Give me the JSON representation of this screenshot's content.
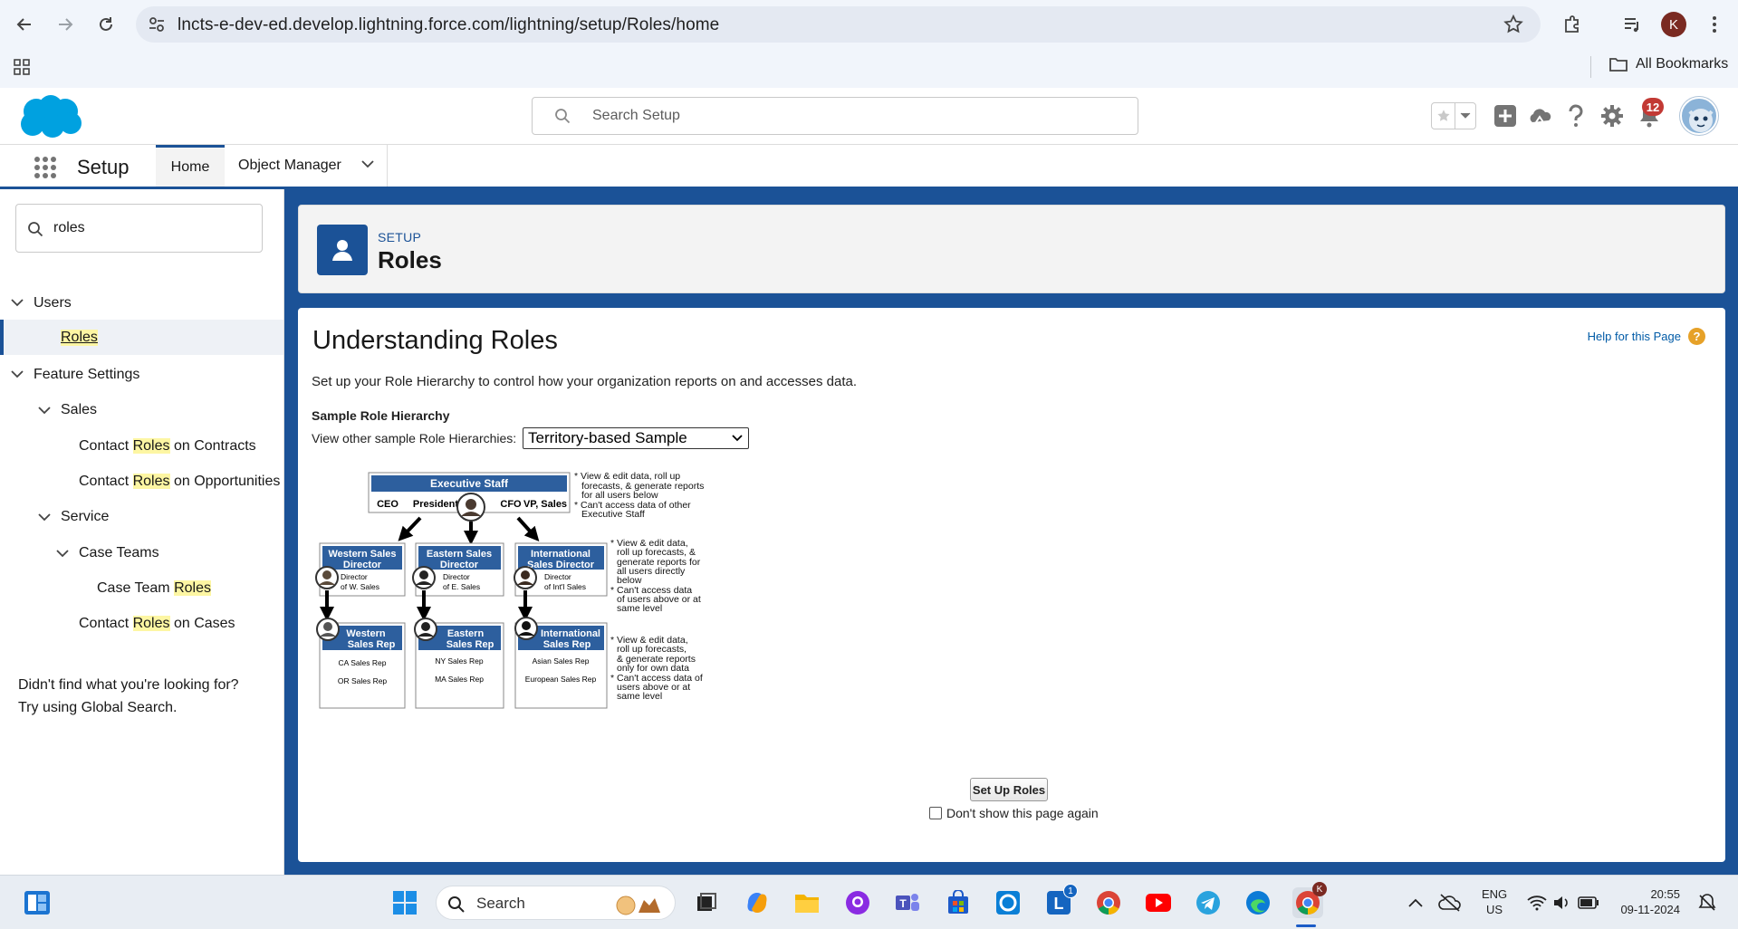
{
  "browser": {
    "url": "lncts-e-dev-ed.develop.lightning.force.com/lightning/setup/Roles/home",
    "profile_initial": "K",
    "bookmarks_label": "All Bookmarks"
  },
  "sf_header": {
    "search_placeholder": "Search Setup",
    "notification_count": "12"
  },
  "app_nav": {
    "app_name": "Setup",
    "tabs": [
      {
        "label": "Home",
        "active": true
      },
      {
        "label": "Object Manager",
        "active": false
      }
    ]
  },
  "sidebar": {
    "quick_find_value": "roles",
    "tree": {
      "users": "Users",
      "roles": "Roles",
      "feature_settings": "Feature Settings",
      "sales": "Sales",
      "contact_1_pre": "Contact ",
      "contact_1_hl": "Roles",
      "contact_1_post": " on Contracts",
      "contact_2_pre": "Contact ",
      "contact_2_hl": "Roles",
      "contact_2_post": " on Opportunities",
      "service": "Service",
      "case_teams": "Case Teams",
      "case_team_pre": "Case Team ",
      "case_team_hl": "Roles",
      "contact_3_pre": "Contact ",
      "contact_3_hl": "Roles",
      "contact_3_post": " on Cases"
    },
    "not_found_line1": "Didn't find what you're looking for?",
    "not_found_line2": "Try using Global Search."
  },
  "page_header": {
    "breadcrumb": "SETUP",
    "title": "Roles"
  },
  "content": {
    "title": "Understanding Roles",
    "help_link": "Help for this Page",
    "description": "Set up your Role Hierarchy to control how your organization reports on and accesses data.",
    "sample_heading": "Sample Role Hierarchy",
    "view_other_label": "View other sample Role Hierarchies:",
    "selected_hierarchy": "Territory-based Sample",
    "setup_button": "Set Up Roles",
    "dont_show_label": "Don't show this page again"
  },
  "diagram": {
    "exec": {
      "title": "Executive Staff",
      "members": [
        "CEO",
        "President",
        "CFO",
        "VP, Sales"
      ],
      "notes": [
        "* View & edit data, roll up",
        "forecasts, & generate reports",
        "for all users below",
        "* Can't access data of other",
        "Executive Staff"
      ]
    },
    "directors": [
      {
        "title1": "Western Sales",
        "title2": "Director",
        "sub1": "Director",
        "sub2": "of W. Sales"
      },
      {
        "title1": "Eastern Sales",
        "title2": "Director",
        "sub1": "Director",
        "sub2": "of E. Sales"
      },
      {
        "title1": "International",
        "title2": "Sales Director",
        "sub1": "Director",
        "sub2": "of Int'l Sales"
      }
    ],
    "director_notes": [
      "* View & edit data,",
      "roll up forecasts, &",
      "generate reports for",
      "all users directly",
      "below",
      "* Can't access data",
      "of users above or at",
      "same level"
    ],
    "reps": [
      {
        "title1": "Western",
        "title2": "Sales Rep",
        "items": [
          "CA Sales Rep",
          "OR Sales Rep"
        ]
      },
      {
        "title1": "Eastern",
        "title2": "Sales Rep",
        "items": [
          "NY Sales Rep",
          "MA Sales Rep"
        ]
      },
      {
        "title1": "International",
        "title2": "Sales Rep",
        "items": [
          "Asian Sales Rep",
          "European Sales Rep"
        ]
      }
    ],
    "rep_notes": [
      "* View & edit data,",
      "roll up forecasts,",
      "& generate reports",
      "only for own data",
      "* Can't access data of",
      "users above or at",
      "same level"
    ]
  },
  "taskbar": {
    "search_placeholder": "Search",
    "lang_line1": "ENG",
    "lang_line2": "US",
    "time": "20:55",
    "date": "09-11-2024",
    "lite_badge": "1"
  },
  "colors": {
    "brand_blue": "#1b5297",
    "sf_cloud": "#00a1e0",
    "highlight": "#fdf6a3",
    "diagram_header": "#2d5f9e",
    "badge_red": "#c23934"
  }
}
